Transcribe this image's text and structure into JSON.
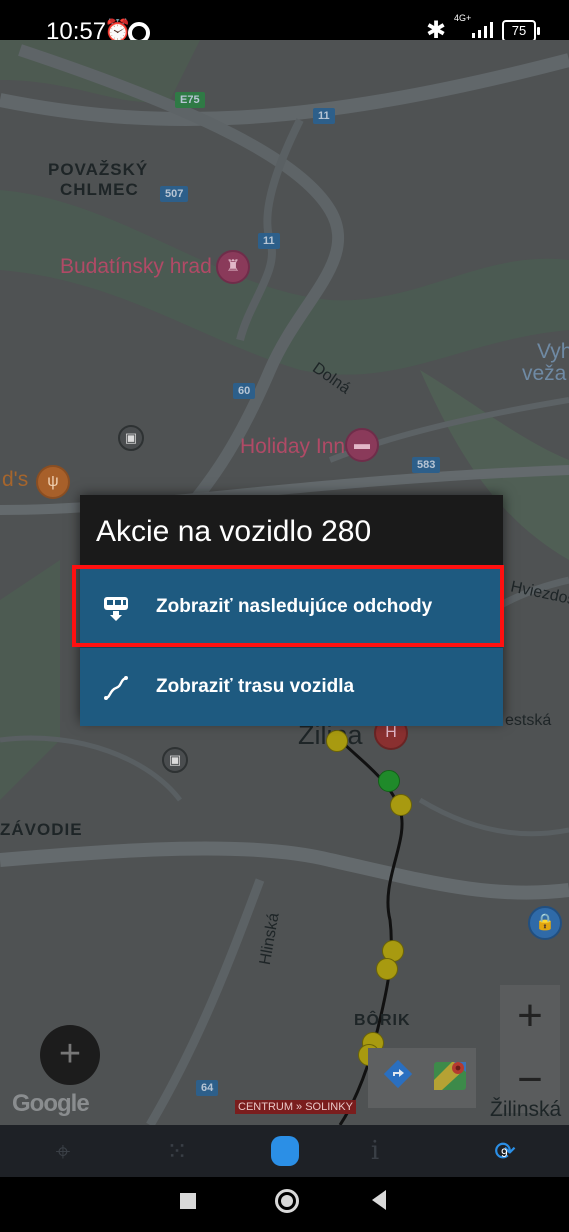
{
  "status_bar": {
    "time": "10:57",
    "network": "4G+",
    "battery": "75"
  },
  "map": {
    "labels": {
      "povazsky": "POVAŽSKÝ",
      "chlmec": "CHLMEC",
      "budatinsky": "Budatínsky hrad",
      "dolna": "Dolná",
      "vyh": "Vyh",
      "veza": "veža",
      "holiday": "Holiday Inn",
      "ds": "d's",
      "hviezdos": "Hviezdos",
      "estska": "estská",
      "zilina": "Žilina",
      "zavodie": "ZÁVODIE",
      "hlinska": "Hlinská",
      "borik": "BÔRIK",
      "zilinska": "Žilinská"
    },
    "road_shields": {
      "e75": "E75",
      "r11a": "11",
      "r507": "507",
      "r11b": "11",
      "r60": "60",
      "r583": "583",
      "r64": "64"
    },
    "route_banner": "CENTRUM » SOLINKY",
    "google_logo": "Google",
    "colors": {
      "map_background": "#4f5253",
      "route_line": "#111111",
      "stop_yellow": "#a89a10",
      "stop_green": "#1f8a2a"
    }
  },
  "dialog": {
    "title": "Akcie na vozidlo 280",
    "actions": [
      {
        "label": "Zobraziť nasledujúce odchody",
        "icon": "bus-departures-icon",
        "highlighted": true
      },
      {
        "label": "Zobraziť trasu vozidla",
        "icon": "route-icon",
        "highlighted": false
      }
    ],
    "accent": "#1e5a80",
    "highlight_color": "#ff1010"
  },
  "controls": {
    "fab": "+",
    "zoom_in": "+",
    "zoom_out": "−"
  },
  "toolbar": {
    "items": [
      "location-icon",
      "scatter-icon",
      "bus-icon",
      "info-icon",
      "refresh-icon"
    ],
    "info": "i",
    "refresh_badge": "9",
    "active_color": "#2b8fe6"
  }
}
